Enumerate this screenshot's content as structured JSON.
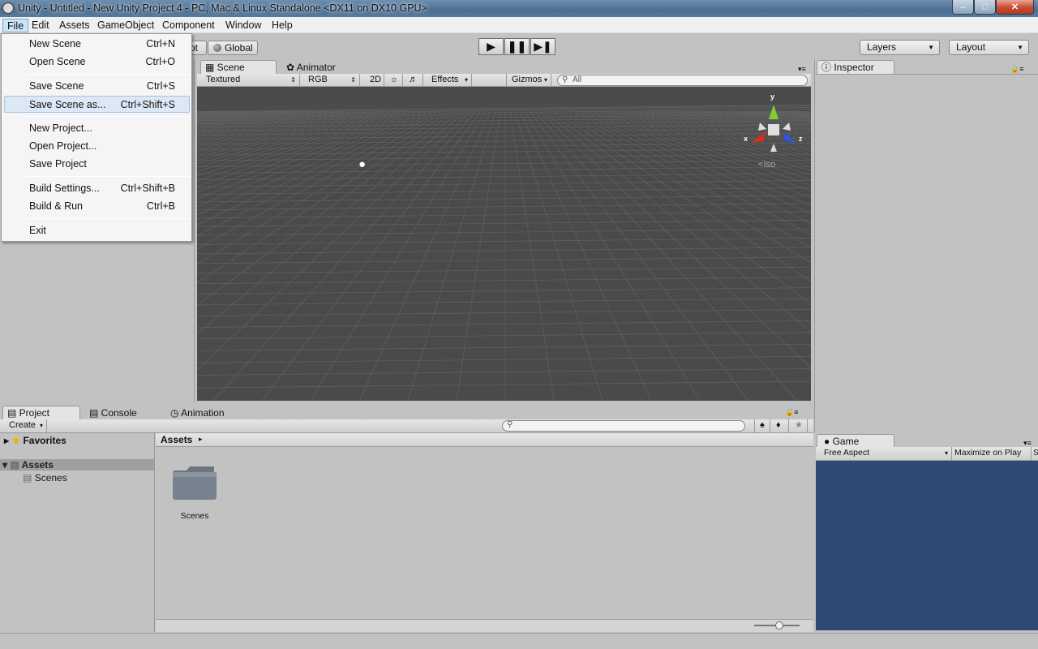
{
  "window": {
    "title": "Unity - Untitled - New Unity Project 4 - PC, Mac & Linux Standalone <DX11 on DX10 GPU>",
    "min_icon": "minimize-icon",
    "max_icon": "maximize-icon",
    "close_icon": "close-icon"
  },
  "menubar": [
    "File",
    "Edit",
    "Assets",
    "GameObject",
    "Component",
    "Window",
    "Help"
  ],
  "file_menu": [
    {
      "label": "New Scene",
      "shortcut": "Ctrl+N"
    },
    {
      "label": "Open Scene",
      "shortcut": "Ctrl+O"
    },
    {
      "label": "Save Scene",
      "shortcut": "Ctrl+S"
    },
    {
      "label": "Save Scene as...",
      "shortcut": "Ctrl+Shift+S"
    },
    {
      "label": "New Project...",
      "shortcut": ""
    },
    {
      "label": "Open Project...",
      "shortcut": ""
    },
    {
      "label": "Save Project",
      "shortcut": ""
    },
    {
      "label": "Build Settings...",
      "shortcut": "Ctrl+Shift+B"
    },
    {
      "label": "Build & Run",
      "shortcut": "Ctrl+B"
    },
    {
      "label": "Exit",
      "shortcut": ""
    }
  ],
  "toolbar": {
    "pivot_label": "ot",
    "global_label": "Global",
    "layers_label": "Layers",
    "layout_label": "Layout"
  },
  "scene_tabs": {
    "scene": "Scene",
    "animator": "Animator"
  },
  "scene_strip": {
    "shading": "Textured",
    "render": "RGB",
    "mode_2d": "2D",
    "effects": "Effects",
    "gizmos": "Gizmos",
    "search_placeholder": "All"
  },
  "gizmo": {
    "y": "y",
    "x": "x",
    "z": "z",
    "projection": "Iso"
  },
  "inspector": {
    "tab": "Inspector"
  },
  "bottom_tabs": {
    "project": "Project",
    "console": "Console",
    "animation": "Animation"
  },
  "project": {
    "create_label": "Create",
    "favorites": "Favorites",
    "assets": "Assets",
    "scenes": "Scenes",
    "breadcrumb": "Assets",
    "folder_label": "Scenes"
  },
  "game": {
    "tab": "Game",
    "aspect": "Free Aspect",
    "maximize": "Maximize on Play",
    "stats_partial": "S"
  },
  "colors": {
    "scene_bg": "#4a4a4a",
    "game_bg": "#2e4a75",
    "accent": "#cde5f7"
  }
}
